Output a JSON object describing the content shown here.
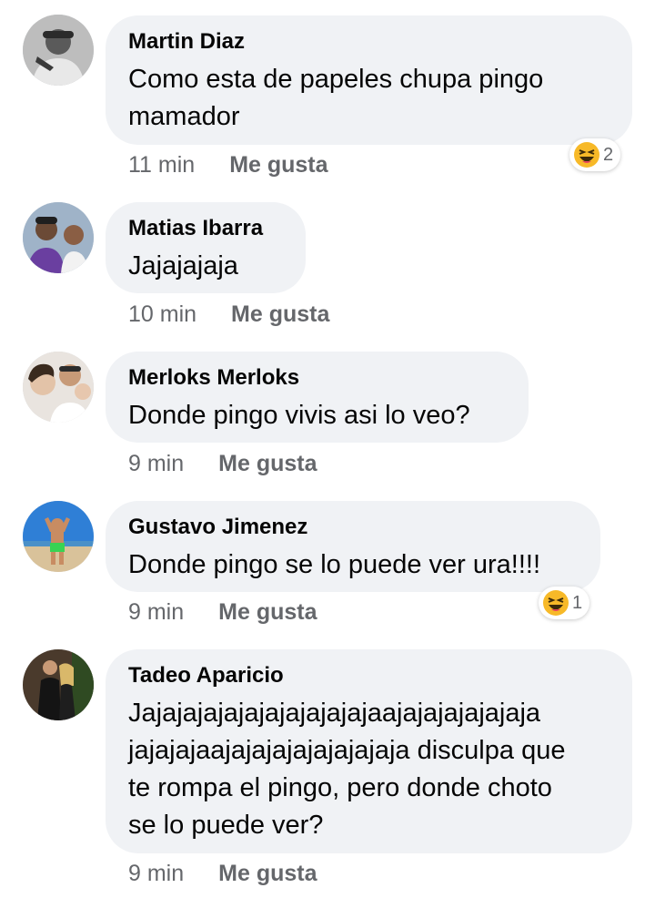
{
  "comments": [
    {
      "author": "Martin Diaz",
      "lines": [
        "Como esta de papeles chupa pingo",
        "mamador"
      ],
      "time": "11 min",
      "like_label": "Me gusta",
      "reaction": {
        "icon": "laughing-face-icon",
        "count": "2"
      }
    },
    {
      "author": "Matias Ibarra",
      "lines": [
        "Jajajajaja"
      ],
      "time": "10 min",
      "like_label": "Me gusta"
    },
    {
      "author": "Merloks Merloks",
      "lines": [
        "Donde pingo vivis asi lo veo?"
      ],
      "time": "9 min",
      "like_label": "Me gusta"
    },
    {
      "author": "Gustavo Jimenez",
      "lines": [
        "Donde pingo se lo puede ver ura!!!!"
      ],
      "time": "9 min",
      "like_label": "Me gusta",
      "reaction": {
        "icon": "laughing-face-icon",
        "count": "1"
      }
    },
    {
      "author": "Tadeo Aparicio",
      "lines": [
        "Jajajajajajajajajajajajaajajajajajajaja",
        "jajajajaajajajajajajajajaja disculpa que",
        "te rompa el pingo, pero donde choto",
        "se lo puede ver?"
      ],
      "time": "9 min",
      "like_label": "Me gusta"
    }
  ],
  "colors": {
    "bubble": "#f0f2f5",
    "meta_text": "#65676b",
    "name_text": "#050505",
    "reaction_face": "#f7b928"
  }
}
